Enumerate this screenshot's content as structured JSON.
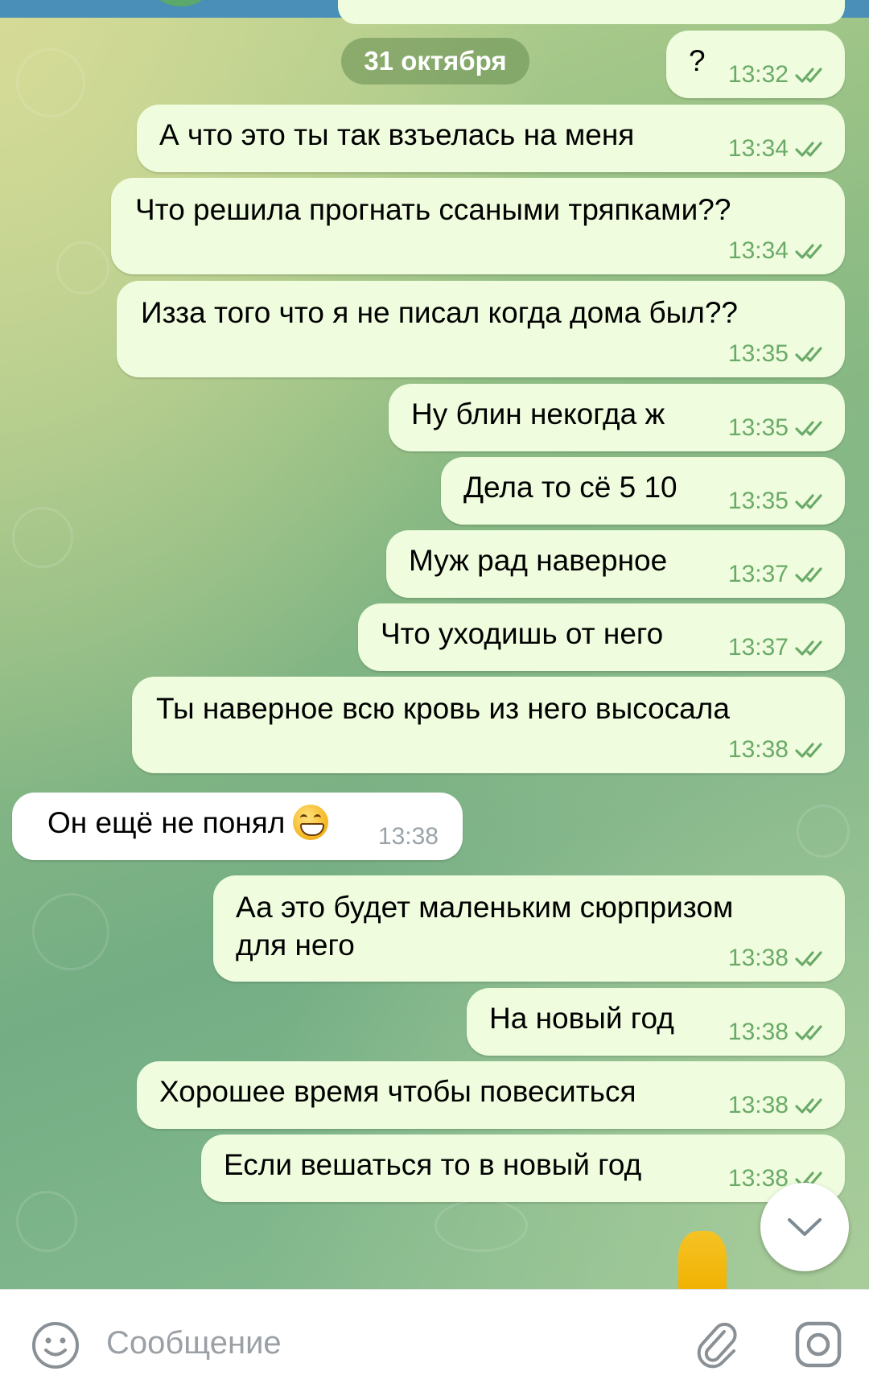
{
  "date_chip": "31 октября",
  "messages": [
    {
      "text": "?",
      "time": "13:32",
      "dir": "out"
    },
    {
      "text": "А что это ты так взъелась на меня",
      "time": "13:34",
      "dir": "out"
    },
    {
      "text": "Что решила прогнать ссаными тряпками??",
      "time": "13:34",
      "dir": "out"
    },
    {
      "text": "Изза того что я не писал когда дома был??",
      "time": "13:35",
      "dir": "out"
    },
    {
      "text": "Ну блин некогда ж",
      "time": "13:35",
      "dir": "out"
    },
    {
      "text": "Дела то сё 5 10",
      "time": "13:35",
      "dir": "out"
    },
    {
      "text": "Муж рад наверное",
      "time": "13:37",
      "dir": "out"
    },
    {
      "text": "Что уходишь от него",
      "time": "13:37",
      "dir": "out"
    },
    {
      "text": "Ты наверное всю кровь из него высосала",
      "time": "13:38",
      "dir": "out"
    },
    {
      "text": "Он ещё не понял",
      "time": "13:38",
      "dir": "in",
      "emoji": "grinning-face"
    },
    {
      "text_line1": "Аа это будет маленьким сюрпризом",
      "text_line2": "для него",
      "time": "13:38",
      "dir": "out"
    },
    {
      "text": "На новый год",
      "time": "13:38",
      "dir": "out"
    },
    {
      "text": "Хорошее время чтобы повеситься",
      "time": "13:38",
      "dir": "out"
    },
    {
      "text": "Если вешаться то в новый год",
      "time": "13:38",
      "dir": "out"
    }
  ],
  "input": {
    "placeholder": "Сообщение"
  },
  "icons": {
    "emoji_button": "smile-icon",
    "attach_button": "paperclip-icon",
    "camera_button": "camera-icon",
    "scroll_down": "chevron-down-icon",
    "read_status": "double-check-icon"
  },
  "colors": {
    "outgoing_bubble": "#effdde",
    "incoming_bubble": "#ffffff",
    "tick_color": "#6aaa68",
    "date_chip": "#7fa36a"
  }
}
